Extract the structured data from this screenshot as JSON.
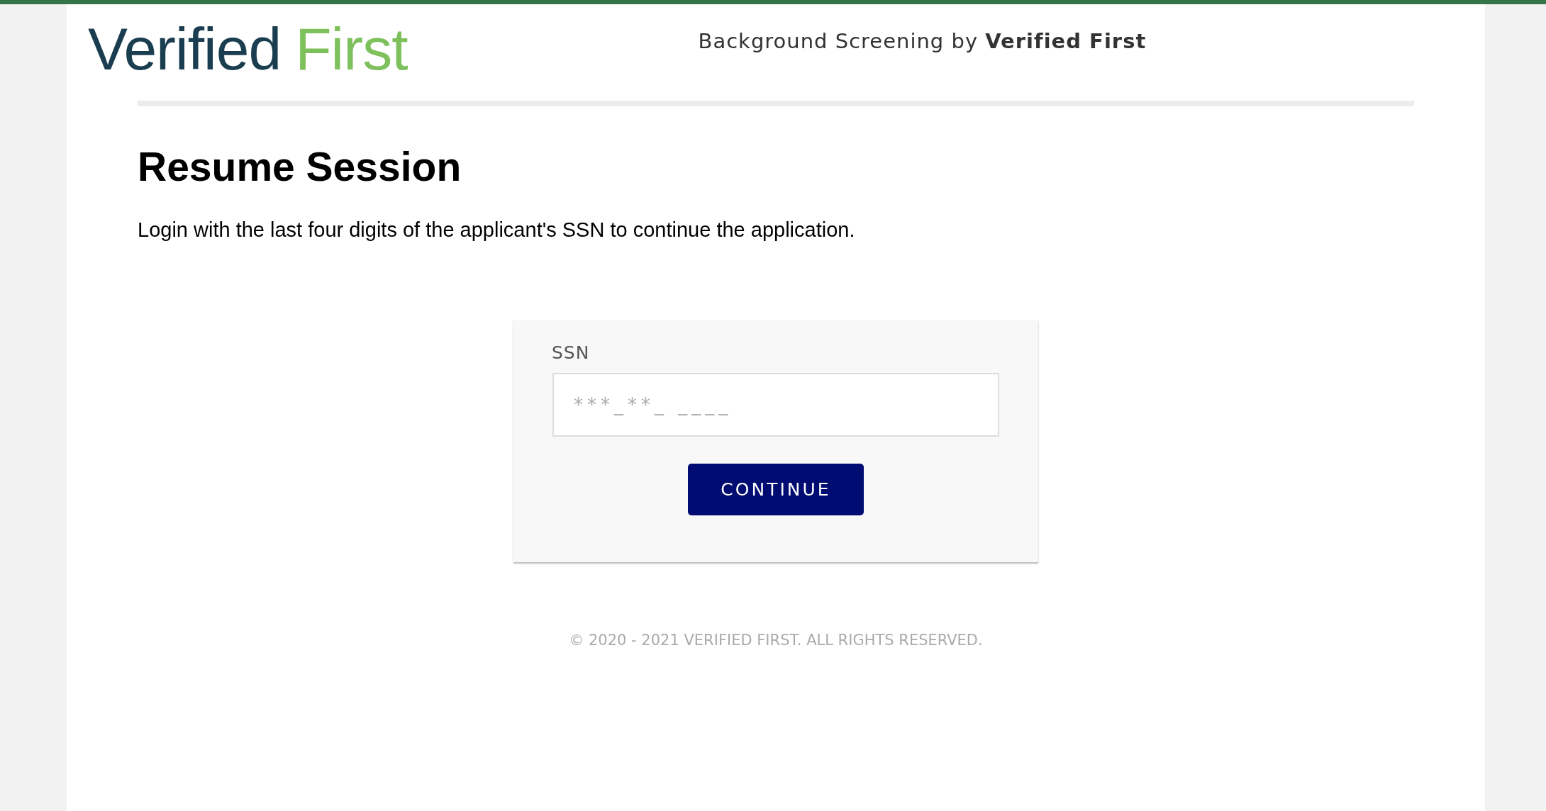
{
  "header": {
    "logo": {
      "primary": "Verified",
      "secondary": "First"
    },
    "tagline": "Background Screening by **Verified First**"
  },
  "title": "Resume Session",
  "description": "Login with the last four digits of the applicant's SSN to continue the application.",
  "form": {
    "field": {
      "label": "SSN",
      "placeholder": "***_**_ ____"
    },
    "button": "CONTINUE"
  },
  "footer": "© 2020 - 2021 VERIFIED FIRST. ALL RIGHTS RESERVED."
}
